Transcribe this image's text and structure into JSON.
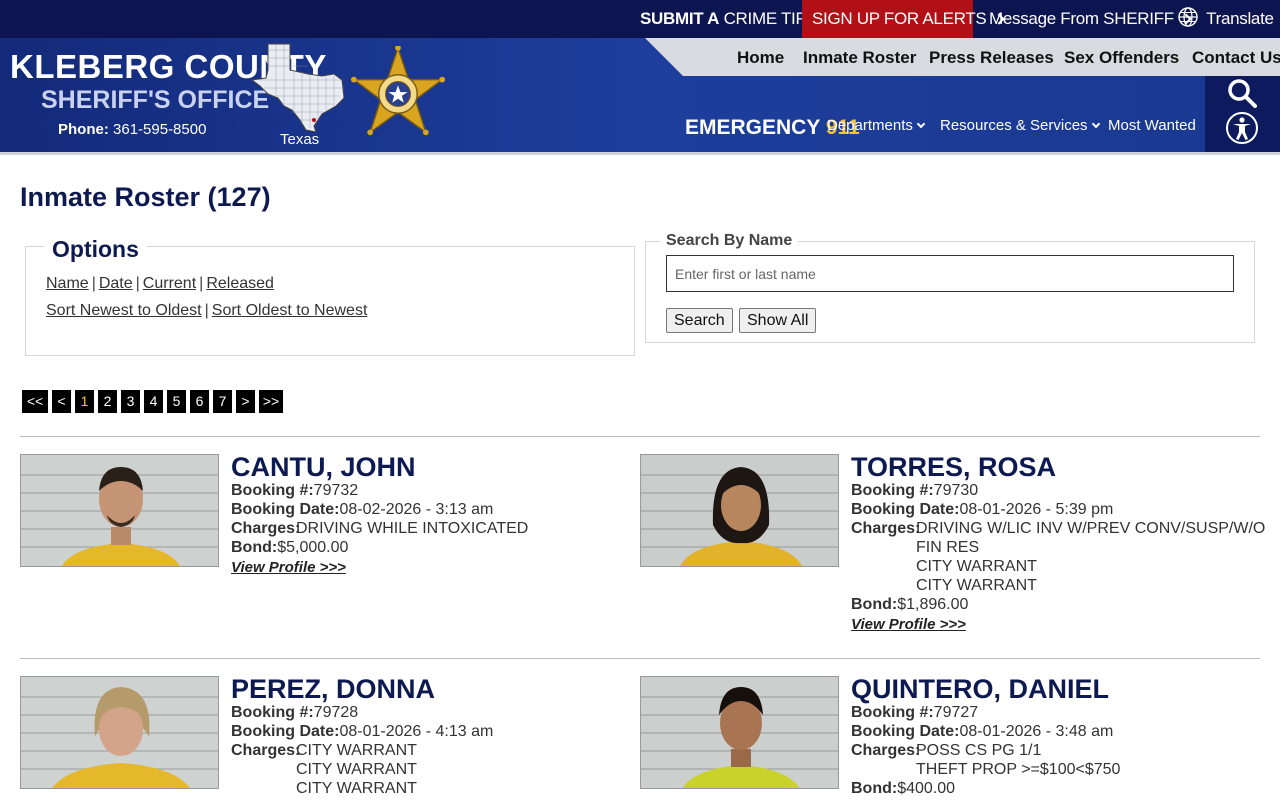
{
  "topbar": {
    "crime_tip_strong": "SUBMIT A",
    "crime_tip_rest": "CRIME TIP",
    "alerts": "SIGN UP FOR ALERTS",
    "message": "Message From SHERIFF",
    "translate": "Translate"
  },
  "brand": {
    "title": "KLEBERG COUNTY",
    "subtitle": "SHERIFF'S OFFICE",
    "phone_label": "Phone:",
    "phone": "361-595-8500",
    "state_label": "Texas"
  },
  "nav": {
    "home": "Home",
    "roster": "Inmate Roster",
    "press": "Press Releases",
    "sex_offenders": "Sex Offenders",
    "contact": "Contact Us"
  },
  "subnav": {
    "emergency_label": "EMERGENCY",
    "emergency_number": "911",
    "departments": "Departments",
    "resources": "Resources & Services",
    "most_wanted": "Most Wanted"
  },
  "page": {
    "title": "Inmate Roster (127)"
  },
  "options": {
    "legend": "Options",
    "filters": [
      "Name",
      "Date",
      "Current",
      "Released"
    ],
    "sorts": [
      "Sort Newest to Oldest",
      "Sort Oldest to Newest"
    ]
  },
  "search": {
    "legend": "Search By Name",
    "placeholder": "Enter first or last name",
    "search_button": "Search",
    "show_all_button": "Show All"
  },
  "pagination": {
    "first": "<<",
    "prev": "<",
    "pages": [
      "1",
      "2",
      "3",
      "4",
      "5",
      "6",
      "7"
    ],
    "current": "1",
    "next": ">",
    "last": ">>"
  },
  "labels": {
    "booking_no": "Booking #:",
    "booking_date": "Booking Date:",
    "charges": "Charges:",
    "bond": "Bond:",
    "view_profile": "View Profile >>>"
  },
  "inmates": [
    {
      "name": "CANTU, JOHN",
      "booking_no": "79732",
      "booking_date": "08-02-2026 - 3:13 am",
      "charges": [
        "DRIVING WHILE INTOXICATED"
      ],
      "bond": "$5,000.00"
    },
    {
      "name": "TORRES, ROSA",
      "booking_no": "79730",
      "booking_date": "08-01-2026 - 5:39 pm",
      "charges": [
        "DRIVING W/LIC INV W/PREV CONV/SUSP/W/O",
        "FIN RES",
        "CITY WARRANT",
        "CITY WARRANT"
      ],
      "bond": "$1,896.00"
    },
    {
      "name": "PEREZ, DONNA",
      "booking_no": "79728",
      "booking_date": "08-01-2026 - 4:13 am",
      "charges": [
        "CITY WARRANT",
        "CITY WARRANT",
        "CITY WARRANT"
      ],
      "bond": ""
    },
    {
      "name": "QUINTERO, DANIEL",
      "booking_no": "79727",
      "booking_date": "08-01-2026 - 3:48 am",
      "charges": [
        "POSS CS PG 1/1",
        "THEFT PROP >=$100<$750"
      ],
      "bond": "$400.00"
    }
  ],
  "colors": {
    "navy": "#0d1550",
    "header_blue": "#1d3e9c",
    "alert_red": "#b11116",
    "gold": "#f5c43a",
    "title_navy": "#0d1a52"
  }
}
